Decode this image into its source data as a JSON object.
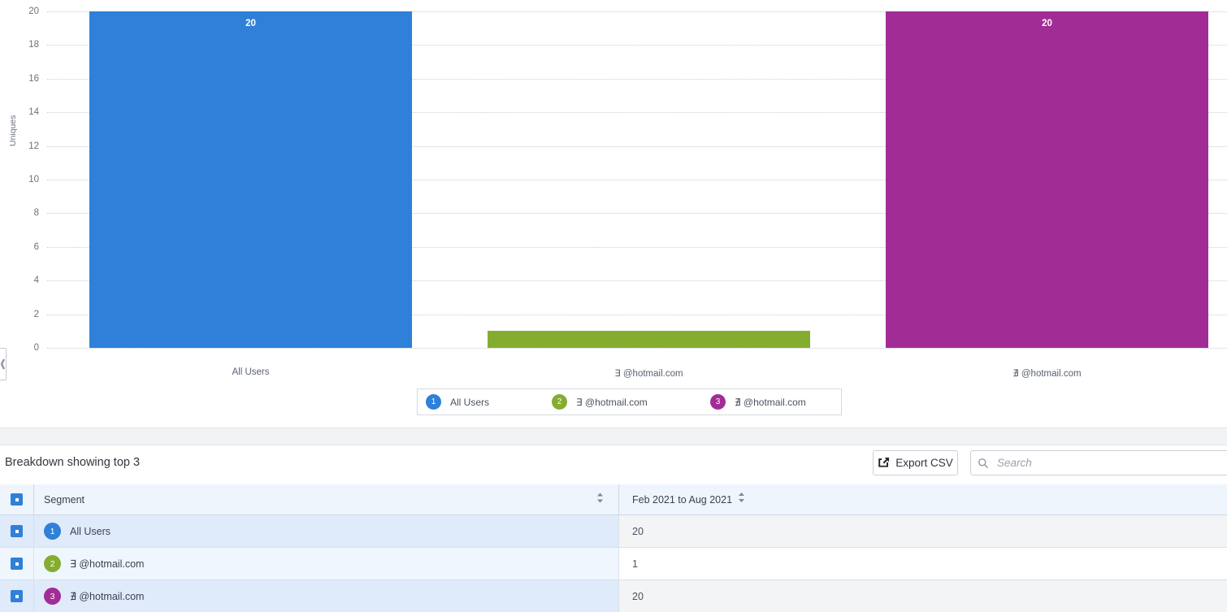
{
  "chart_data": {
    "type": "bar",
    "title": "",
    "xlabel": "",
    "ylabel": "Uniques",
    "ylim": [
      0,
      20
    ],
    "yticks": [
      20,
      18,
      16,
      14,
      12,
      10,
      8,
      6,
      4,
      2,
      0
    ],
    "grid": true,
    "legend_position": "bottom",
    "categories": [
      "All Users",
      "∃ @hotmail.com",
      "∄ @hotmail.com"
    ],
    "values": [
      20,
      1,
      20
    ],
    "data_labels": [
      "20",
      "",
      "20"
    ],
    "colors": [
      "#2f80d8",
      "#84ad2f",
      "#a22c96"
    ],
    "legend": [
      {
        "index": "1",
        "label": "All Users",
        "color": "#2f80d8"
      },
      {
        "index": "2",
        "label": "∃ @hotmail.com",
        "color": "#84ad2f"
      },
      {
        "index": "3",
        "label": "∄ @hotmail.com",
        "color": "#a22c96"
      }
    ]
  },
  "chart": {
    "y_axis_title": "Uniques",
    "ticks": [
      "20",
      "18",
      "16",
      "14",
      "12",
      "10",
      "8",
      "6",
      "4",
      "2",
      "0"
    ],
    "bars": [
      {
        "label": "All Users",
        "value_label": "20",
        "color": "#2f80d8"
      },
      {
        "label": "∃ @hotmail.com",
        "value_label": "",
        "color": "#84ad2f"
      },
      {
        "label": "∄ @hotmail.com",
        "value_label": "20",
        "color": "#a22c96"
      }
    ]
  },
  "toolbar": {
    "breakdown_title": "Breakdown showing top 3",
    "export_label": "Export CSV",
    "export_icon": "external-link-icon",
    "search_placeholder": "Search",
    "search_value": "",
    "search_icon": "search-icon"
  },
  "table": {
    "headers": {
      "segment": "Segment",
      "period": "Feb 2021 to Aug 2021"
    },
    "rows": [
      {
        "index": "1",
        "segment": "All Users",
        "value": "20",
        "color": "#2f80d8"
      },
      {
        "index": "2",
        "segment": "∃ @hotmail.com",
        "value": "1",
        "color": "#84ad2f"
      },
      {
        "index": "3",
        "segment": "∄ @hotmail.com",
        "value": "20",
        "color": "#a22c96"
      }
    ]
  },
  "panel_handle": {
    "icon": "chevron-left-icon"
  }
}
